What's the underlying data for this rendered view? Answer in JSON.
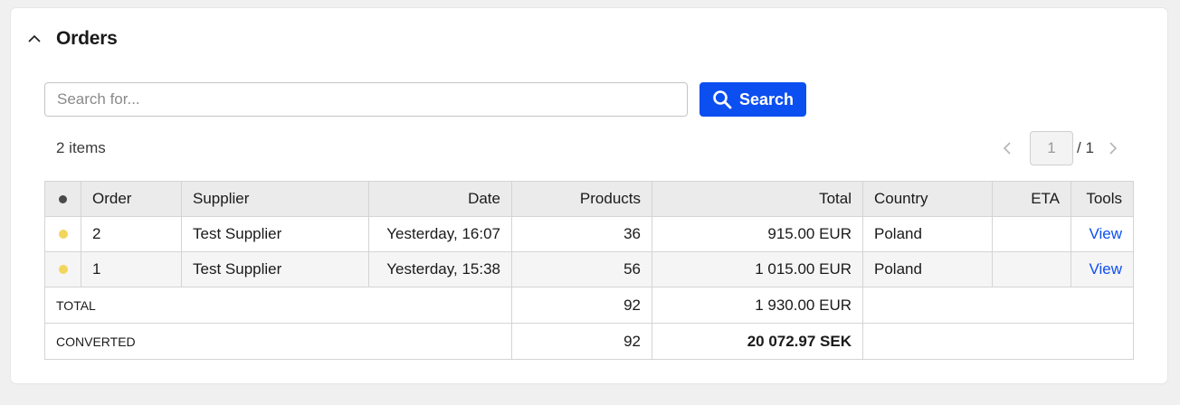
{
  "panel": {
    "title": "Orders",
    "collapse_icon": "chevron-up-icon"
  },
  "search": {
    "placeholder": "Search for...",
    "value": "",
    "button_label": "Search",
    "button_icon": "search-icon",
    "accent_color": "#0c4ff0"
  },
  "summary": {
    "items_count": "2 items"
  },
  "pagination": {
    "current_page": "1",
    "total_pages": "/ 1",
    "prev_icon": "chevron-left-icon",
    "next_icon": "chevron-right-icon"
  },
  "table": {
    "columns": {
      "status": "",
      "order": "Order",
      "supplier": "Supplier",
      "date": "Date",
      "products": "Products",
      "total": "Total",
      "country": "Country",
      "eta": "ETA",
      "tools": "Tools"
    },
    "rows": [
      {
        "status_color": "#f3d55b",
        "order": "2",
        "supplier": "Test Supplier",
        "date": "Yesterday, 16:07",
        "products": "36",
        "total": "915.00 EUR",
        "country": "Poland",
        "eta": "",
        "action": "View"
      },
      {
        "status_color": "#f3d55b",
        "order": "1",
        "supplier": "Test Supplier",
        "date": "Yesterday, 15:38",
        "products": "56",
        "total": "1 015.00 EUR",
        "country": "Poland",
        "eta": "",
        "action": "View"
      }
    ],
    "footer": {
      "total": {
        "label": "TOTAL",
        "products": "92",
        "amount": "1 930.00 EUR"
      },
      "converted": {
        "label": "CONVERTED",
        "products": "92",
        "amount": "20 072.97 SEK"
      }
    }
  }
}
